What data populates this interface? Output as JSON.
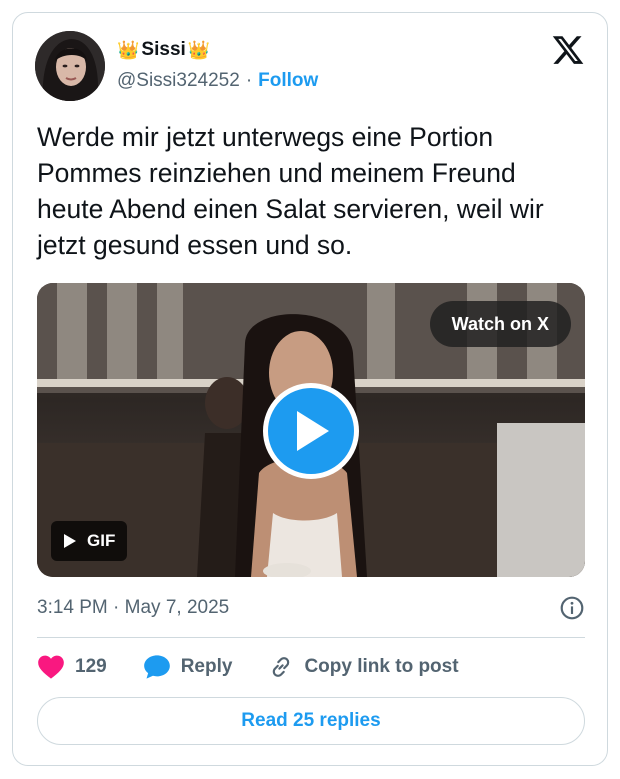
{
  "author": {
    "display_name": "Sissi",
    "crown_left": "👑",
    "crown_right": "👑",
    "handle": "@Sissi324252",
    "separator": "·",
    "follow_label": "Follow"
  },
  "tweet": {
    "text": "Werde mir jetzt unterwegs eine Portion Pommes reinziehen und meinem Freund heute Abend einen Salat servieren, weil wir jetzt gesund essen und so."
  },
  "media": {
    "watch_label": "Watch on X",
    "gif_label": "GIF"
  },
  "meta": {
    "timestamp": "3:14 PM · May 7, 2025"
  },
  "actions": {
    "like_count": "129",
    "reply_label": "Reply",
    "copy_label": "Copy link to post"
  },
  "footer": {
    "read_replies_label": "Read 25 replies"
  },
  "colors": {
    "accent": "#1d9bf0",
    "like": "#f91880",
    "muted": "#536471",
    "border": "#cfd9de"
  }
}
